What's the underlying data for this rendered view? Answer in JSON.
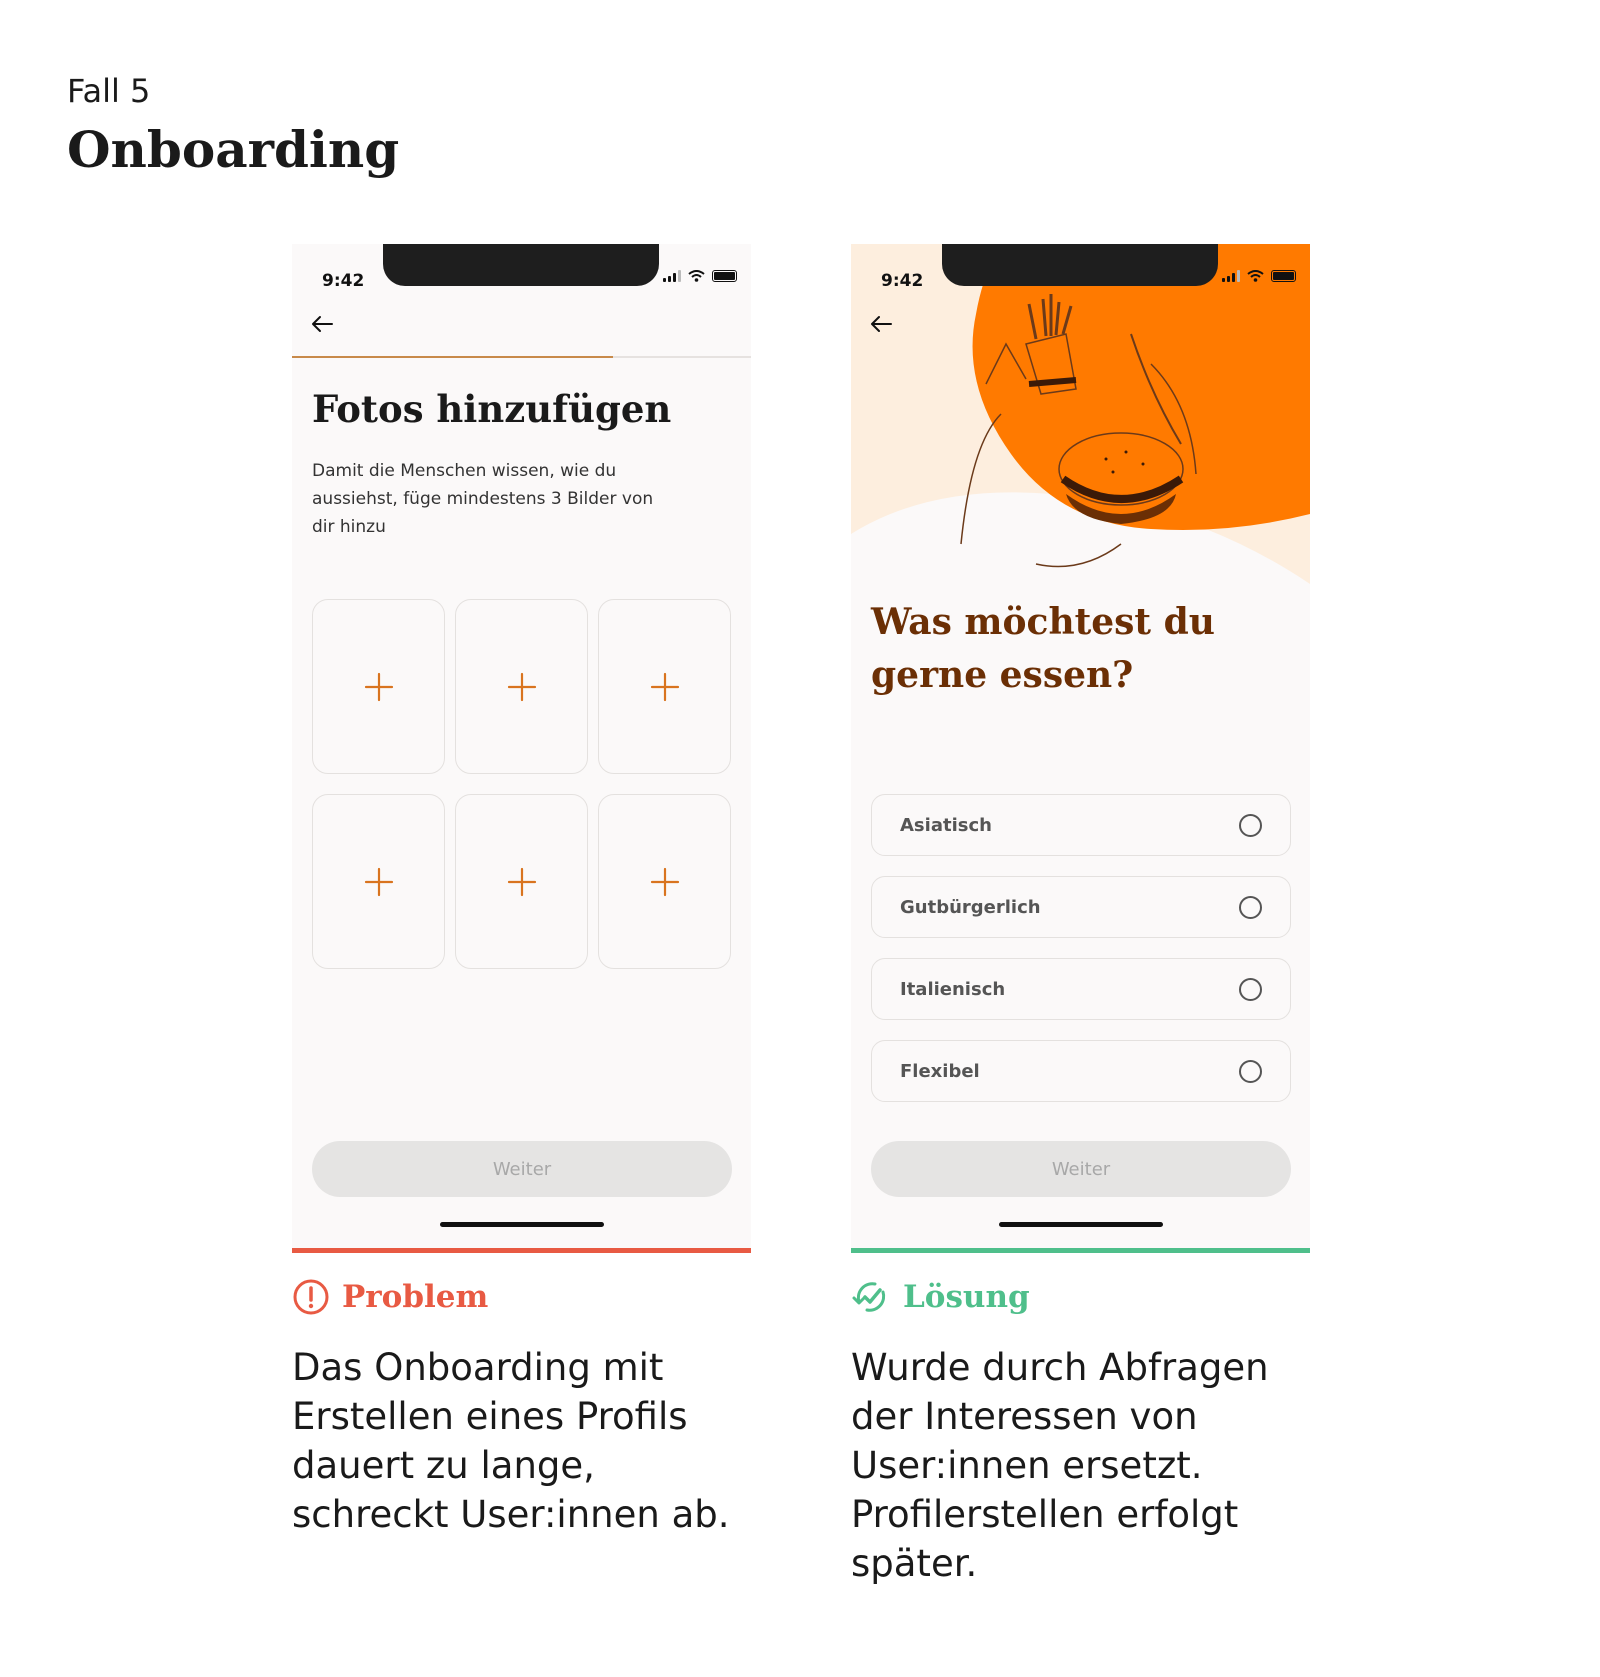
{
  "header": {
    "case_label": "Fall 5",
    "title": "Onboarding"
  },
  "left_phone": {
    "time": "9:42",
    "progress": 0.7,
    "title": "Fotos hinzufügen",
    "description": "Damit die Menschen wissen, wie du aussiehst, füge mindestens 3 Bilder von dir hinzu",
    "slot_icon": "plus-icon",
    "button_label": "Weiter"
  },
  "right_phone": {
    "time": "9:42",
    "question": "Was möchtest du gerne essen?",
    "options": [
      {
        "label": "Asiatisch"
      },
      {
        "label": "Gutbürgerlich"
      },
      {
        "label": "Italienisch"
      },
      {
        "label": "Flexibel"
      }
    ],
    "button_label": "Weiter"
  },
  "problem": {
    "heading": "Problem",
    "text": "Das Onboarding mit Erstellen eines Profils dauert zu lange, schreckt User:innen ab."
  },
  "solution": {
    "heading": "Lösung",
    "text": "Wurde durch Abfragen der Interessen von User:innen ersetzt. Profilerstellen erfolgt später."
  },
  "colors": {
    "accent_orange": "#ff7a00",
    "plus_orange": "#d9741f",
    "problem_red": "#e85a43",
    "solution_green": "#4fbf8b",
    "question_brown": "#6b2f05"
  }
}
